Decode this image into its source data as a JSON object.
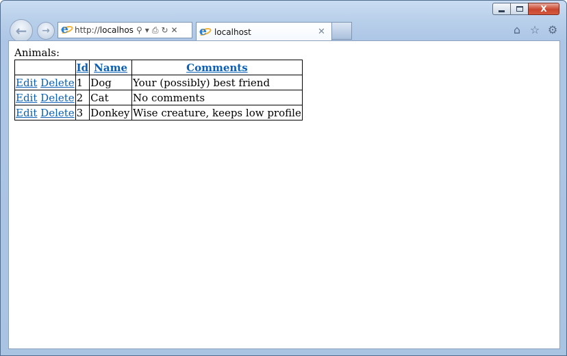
{
  "window": {
    "caption_buttons": {
      "close": "X"
    }
  },
  "nav": {
    "back": "←",
    "forward": "→"
  },
  "address_bar": {
    "prefix": "http://",
    "host": "localhost",
    "suffix": "/",
    "tools": [
      "⚲",
      "▾",
      "⎙",
      "↻",
      "✕"
    ]
  },
  "tab": {
    "title": "localhost",
    "close": "✕"
  },
  "toolbar_icons": [
    "home-icon",
    "star-icon",
    "gear-icon"
  ],
  "page": {
    "heading": "Animals:",
    "columns": [
      "",
      "Id",
      "Name",
      "Comments"
    ],
    "actions": {
      "edit": "Edit",
      "delete": "Delete"
    },
    "rows": [
      {
        "id": "1",
        "name": "Dog",
        "comments": "Your (possibly) best friend"
      },
      {
        "id": "2",
        "name": "Cat",
        "comments": "No comments"
      },
      {
        "id": "3",
        "name": "Donkey",
        "comments": "Wise creature, keeps low profile"
      }
    ]
  },
  "colors": {
    "link": "#0b5fb4",
    "chrome": "#b8cfea",
    "close_button": "#c8452d"
  }
}
